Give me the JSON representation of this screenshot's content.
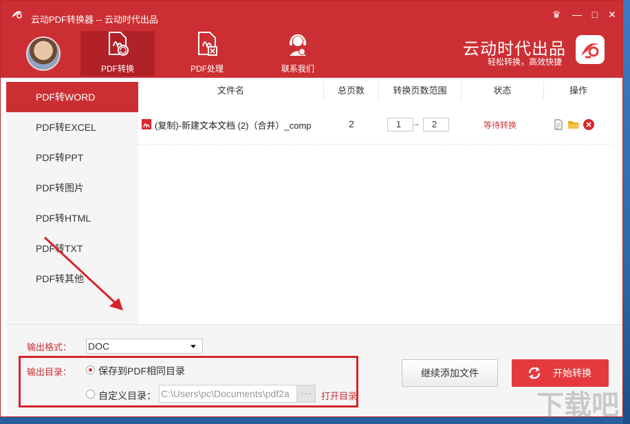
{
  "window": {
    "title": "云动PDF转换器 -- 云动时代出品"
  },
  "window_controls": [
    "♛",
    "—",
    "□",
    "✕"
  ],
  "nav": {
    "tabs": [
      {
        "label": "PDF转换",
        "icon": "pdf-convert-icon"
      },
      {
        "label": "PDF处理",
        "icon": "pdf-process-icon"
      },
      {
        "label": "联系我们",
        "icon": "headset-icon"
      }
    ]
  },
  "brand": {
    "name": "云动时代出品",
    "slogan": "轻松转换，高效快捷"
  },
  "sidebar": {
    "items": [
      {
        "label": "PDF转WORD"
      },
      {
        "label": "PDF转EXCEL"
      },
      {
        "label": "PDF转PPT"
      },
      {
        "label": "PDF转图片"
      },
      {
        "label": "PDF转HTML"
      },
      {
        "label": "PDF转TXT"
      },
      {
        "label": "PDF转其他"
      }
    ]
  },
  "table": {
    "headers": [
      "文件名",
      "总页数",
      "转换页数范围",
      "状态",
      "操作"
    ],
    "rows": [
      {
        "filename": "(复制)-新建文本文档 (2)（合并）_comp",
        "pages": "2",
        "range_from": "1",
        "range_to": "2",
        "status": "等待转换"
      }
    ]
  },
  "output": {
    "format_label": "输出格式：",
    "format_value": "DOC",
    "dir_label": "输出目录：",
    "option_same": "保存到PDF相同目录",
    "option_custom": "自定义目录：",
    "custom_path": "C:\\Users\\pc\\Documents\\pdf2a",
    "browse": "···",
    "open_dir": "打开目录"
  },
  "buttons": {
    "add_files": "继续添加文件",
    "start": "开始转换"
  },
  "colors": {
    "brand_red": "#cc2f33",
    "active_red": "#b12228",
    "start_button": "#e53a3d",
    "status_red": "#d1393c"
  },
  "watermark": "下载吧"
}
